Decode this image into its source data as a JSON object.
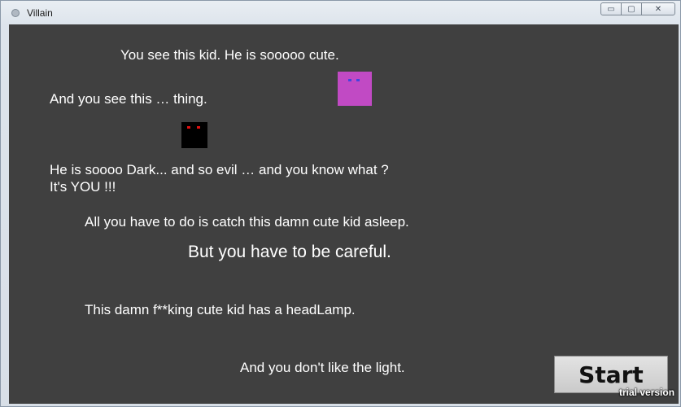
{
  "window": {
    "title": "Villain",
    "controls": {
      "minimize": "▭",
      "maximize": "▢",
      "close": "✕"
    }
  },
  "intro": {
    "line1": "You see this kid. He is sooooo cute.",
    "line2": "And you see this … thing.",
    "line3a": "He is soooo Dark... and so evil … and you know what ?",
    "line3b": "It's YOU !!!",
    "line4": "All you have to do is catch this damn cute kid asleep.",
    "line5": "But you have to be careful.",
    "line6": "This damn f**king cute kid has a headLamp.",
    "line7": "And you don't like the light."
  },
  "start_button": {
    "label": "Start"
  },
  "watermark": "trial version",
  "colors": {
    "canvas": "#404040",
    "kid": "#c14ac4",
    "kid_eyes": "#4444dd",
    "villain": "#000000",
    "villain_eyes": "#e01010",
    "text": "#ffffff"
  }
}
